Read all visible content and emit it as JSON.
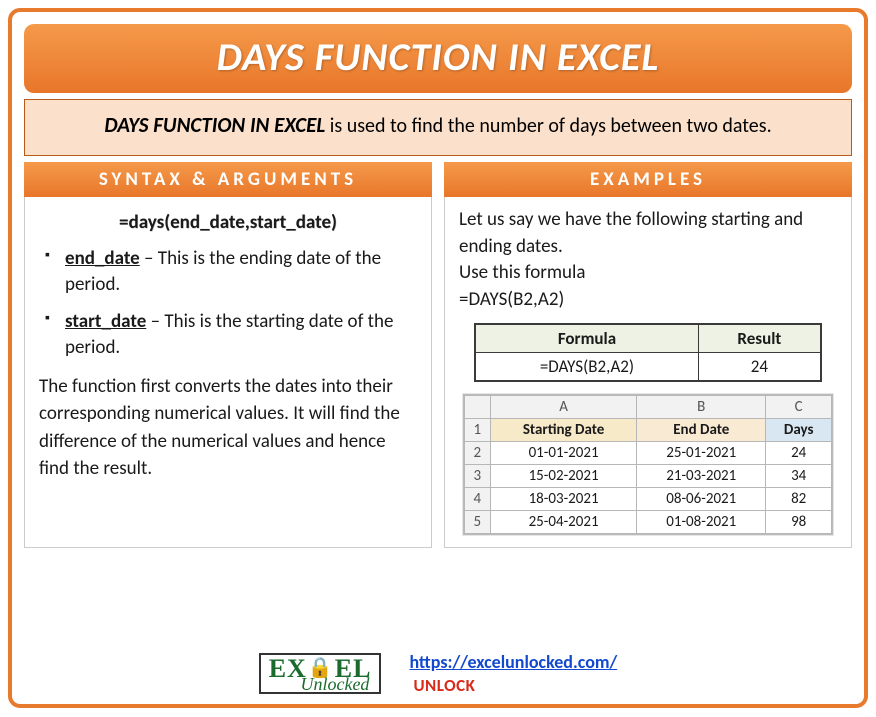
{
  "title": "DAYS FUNCTION IN EXCEL",
  "desc": {
    "bold": "DAYS FUNCTION IN EXCEL",
    "rest": " is used to find the number of days between two dates."
  },
  "syntax": {
    "heading": "SYNTAX & ARGUMENTS",
    "formula": "=days(end_date,start_date)",
    "args": [
      {
        "name": "end_date",
        "text": " – This is the ending date of the period."
      },
      {
        "name": "start_date",
        "text": " – This is the starting date of the period."
      }
    ],
    "explain": "The function first converts the dates into their corresponding numerical values. It will find the difference of the numerical values and hence find the result."
  },
  "examples": {
    "heading": "EXAMPLES",
    "intro1": "Let us say we have the following starting and ending dates.",
    "intro2": "Use this formula",
    "intro3": "=DAYS(B2,A2)",
    "formula_table": {
      "h1": "Formula",
      "h2": "Result",
      "c1": "=DAYS(B2,A2)",
      "c2": "24"
    },
    "sheet": {
      "cols": [
        "A",
        "B",
        "C"
      ],
      "headers": [
        "Starting Date",
        "End Date",
        "Days"
      ],
      "rows": [
        [
          "01-01-2021",
          "25-01-2021",
          "24"
        ],
        [
          "15-02-2021",
          "21-03-2021",
          "34"
        ],
        [
          "18-03-2021",
          "08-06-2021",
          "82"
        ],
        [
          "25-04-2021",
          "01-08-2021",
          "98"
        ]
      ]
    }
  },
  "footer": {
    "logo_top": "EXCEL",
    "logo_bottom": "Unlocked",
    "url": "https://excelunlocked.com/",
    "unlock": "UNLOCK"
  }
}
